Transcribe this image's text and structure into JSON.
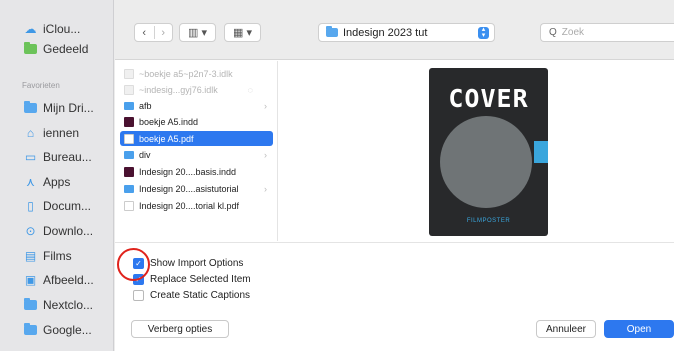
{
  "sidebar": {
    "top_items": [
      {
        "label": "iClou...",
        "icon": "cloud-icon"
      },
      {
        "label": "Gedeeld",
        "icon": "shared-folder-icon"
      }
    ],
    "section_label": "Favorieten",
    "items": [
      {
        "label": "Mijn Dri...",
        "icon": "folder-icon"
      },
      {
        "label": "iennen",
        "icon": "home-icon"
      },
      {
        "label": "Bureau...",
        "icon": "desktop-icon"
      },
      {
        "label": "Apps",
        "icon": "apps-icon"
      },
      {
        "label": "Docum...",
        "icon": "document-icon"
      },
      {
        "label": "Downlo...",
        "icon": "download-icon"
      },
      {
        "label": "Films",
        "icon": "film-icon"
      },
      {
        "label": "Afbeeld...",
        "icon": "image-icon"
      },
      {
        "label": "Nextclo...",
        "icon": "folder-icon"
      },
      {
        "label": "Google...",
        "icon": "folder-icon"
      }
    ]
  },
  "toolbar": {
    "back": "‹",
    "forward": "›",
    "view_columns_icon": "column-view-icon",
    "view_grid_icon": "grid-view-icon",
    "location": "Indesign 2023 tut",
    "search_placeholder": "Zoek"
  },
  "files": [
    {
      "name": "~boekje a5~p2n7-3.idlk",
      "type": "dimdoc",
      "dim": true
    },
    {
      "name": "~indesig...gyj76.idlk",
      "type": "dimdoc",
      "dim": true
    },
    {
      "name": "afb",
      "type": "folder",
      "chevron": true
    },
    {
      "name": "boekje A5.indd",
      "type": "indd"
    },
    {
      "name": "boekje A5.pdf",
      "type": "pdf",
      "selected": true
    },
    {
      "name": "div",
      "type": "folder",
      "chevron": true
    },
    {
      "name": "Indesign 20....basis.indd",
      "type": "indd"
    },
    {
      "name": "Indesign 20....asistutorial",
      "type": "folder",
      "chevron": true
    },
    {
      "name": "Indesign 20....torial kl.pdf",
      "type": "pdf"
    }
  ],
  "preview": {
    "title": "COVER",
    "subtitle": "FILMPOSTER"
  },
  "options": [
    {
      "label": "Show Import Options",
      "checked": true
    },
    {
      "label": "Replace Selected Item",
      "checked": true
    },
    {
      "label": "Create Static Captions",
      "checked": false
    }
  ],
  "buttons": {
    "hide_options": "Verberg opties",
    "cancel": "Annuleer",
    "open": "Open"
  },
  "colors": {
    "accent": "#2d78ef",
    "highlight_ring": "#e0231c"
  }
}
